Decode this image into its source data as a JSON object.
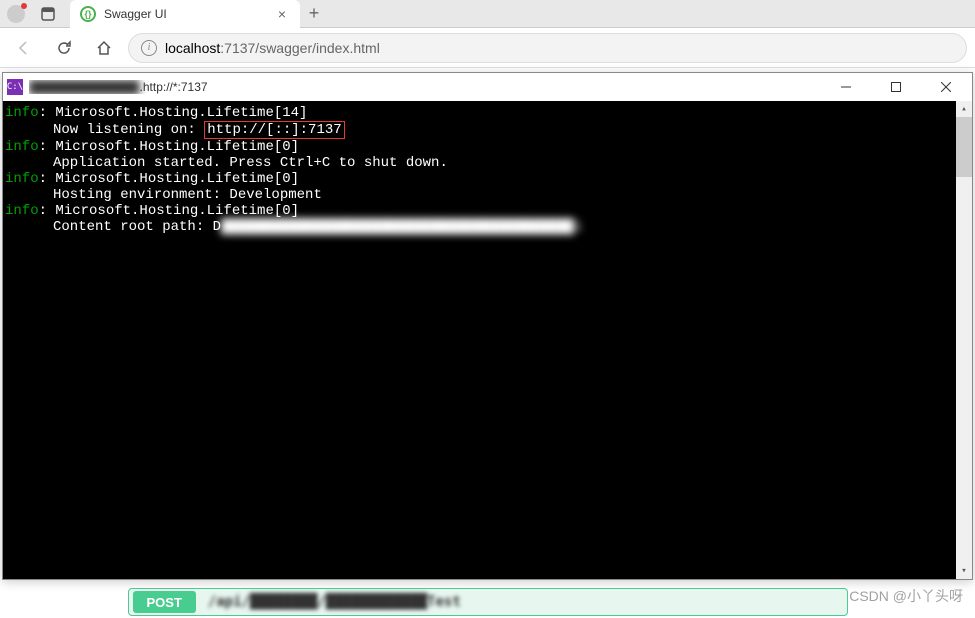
{
  "browser": {
    "tab": {
      "title": "Swagger UI",
      "favicon": "swagger"
    },
    "url": {
      "host": "localhost",
      "path": ":7137/swagger/index.html"
    }
  },
  "console_window": {
    "icon_text": "C:\\",
    "title_hidden": "█████████████",
    "title_visible": ".http://*:7137",
    "logs": [
      {
        "level": "info",
        "source": "Microsoft.Hosting.Lifetime[14]",
        "message_prefix": "Now listening on: ",
        "highlighted": "http://[::]:7137"
      },
      {
        "level": "info",
        "source": "Microsoft.Hosting.Lifetime[0]",
        "message": "Application started. Press Ctrl+C to shut down."
      },
      {
        "level": "info",
        "source": "Microsoft.Hosting.Lifetime[0]",
        "message": "Hosting environment: Development"
      },
      {
        "level": "info",
        "source": "Microsoft.Hosting.Lifetime[0]",
        "message_prefix": "Content root path: D",
        "blurred_suffix": "██████████████████████████████████████████i"
      }
    ]
  },
  "swagger": {
    "method": "POST",
    "path": "/api/████████/████████████Test"
  },
  "watermark": "CSDN @小丫头呀"
}
